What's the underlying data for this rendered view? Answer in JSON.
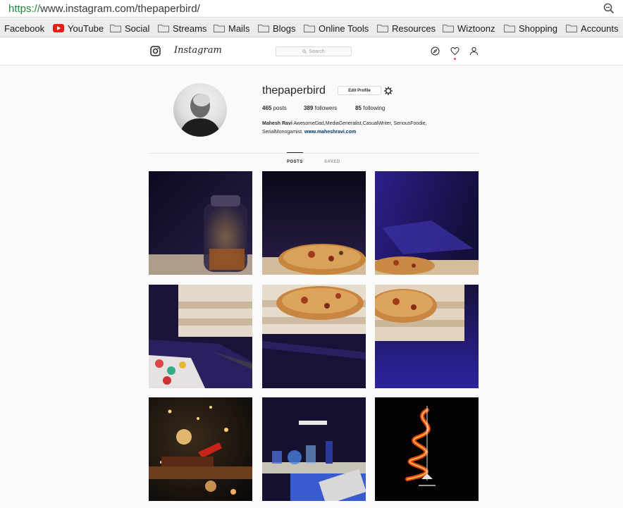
{
  "browser": {
    "url_scheme": "https://",
    "url_rest": "www.instagram.com/thepaperbird/",
    "bookmarks": [
      {
        "label": "Facebook",
        "icon": "none"
      },
      {
        "label": "YouTube",
        "icon": "youtube-icon"
      },
      {
        "label": "Social",
        "icon": "folder-icon"
      },
      {
        "label": "Streams",
        "icon": "folder-icon"
      },
      {
        "label": "Mails",
        "icon": "folder-icon"
      },
      {
        "label": "Blogs",
        "icon": "folder-icon"
      },
      {
        "label": "Online Tools",
        "icon": "folder-icon"
      },
      {
        "label": "Resources",
        "icon": "folder-icon"
      },
      {
        "label": "Wiztoonz",
        "icon": "folder-icon"
      },
      {
        "label": "Shopping",
        "icon": "folder-icon"
      },
      {
        "label": "Accounts",
        "icon": "folder-icon"
      }
    ]
  },
  "header": {
    "wordmark": "Instagram",
    "search_placeholder": "Search",
    "icons": [
      "camera-logo-icon",
      "compass-icon",
      "heart-icon",
      "person-icon"
    ]
  },
  "profile": {
    "username": "thepaperbird",
    "edit_label": "Edit Profile",
    "posts_count": "465",
    "posts_label": "posts",
    "followers_count": "389",
    "followers_label": "followers",
    "following_count": "85",
    "following_label": "following",
    "bio_name": "Mahesh Ravi",
    "bio_text_1": "AwesomeDad,MediaGeneralist,CasualWriter, SeriousFoodie,",
    "bio_text_2": "SerialMonogamist.",
    "bio_link": "www.maheshravi.com"
  },
  "tabs": {
    "posts": "POSTS",
    "saved": "SAVED"
  },
  "colors": {
    "link": "#003569",
    "text": "#262626",
    "border": "#dbdbdb",
    "url_green": "#1f8a3a"
  }
}
